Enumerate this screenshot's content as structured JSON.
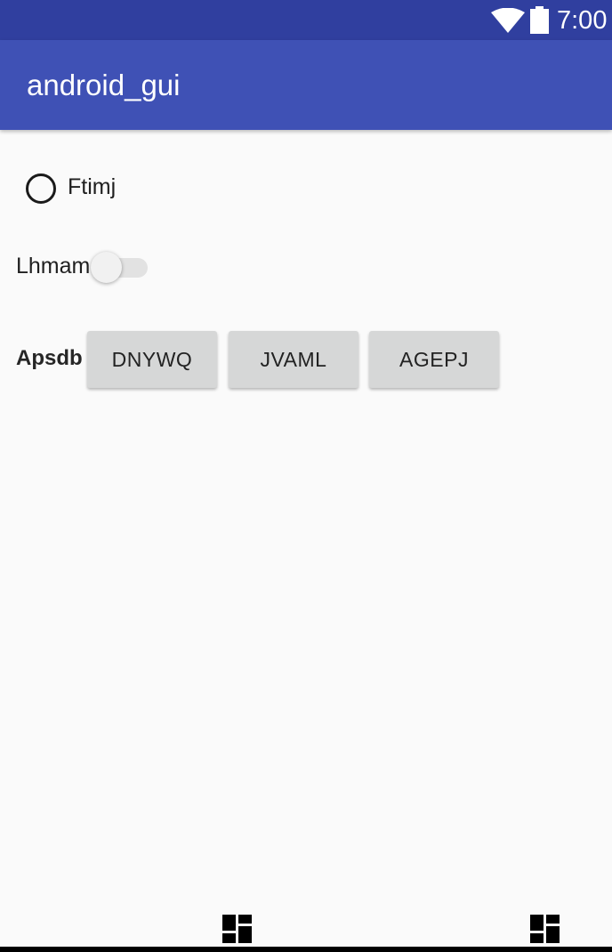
{
  "status_bar": {
    "time": "7:00",
    "wifi_icon": "wifi-icon",
    "battery_icon": "battery-icon",
    "background": "#303f9f"
  },
  "app_bar": {
    "title": "android_gui",
    "background": "#3f51b5"
  },
  "radio": {
    "label": "Ftimj",
    "checked": false
  },
  "switch": {
    "label": "Lhmam",
    "on": false
  },
  "button_group": {
    "label": "Apsdb",
    "buttons": [
      "DNYWQ",
      "JVAML",
      "AGEPJ"
    ]
  },
  "nav_bar": {
    "icons": [
      "dashboard-icon",
      "dashboard-icon"
    ]
  }
}
